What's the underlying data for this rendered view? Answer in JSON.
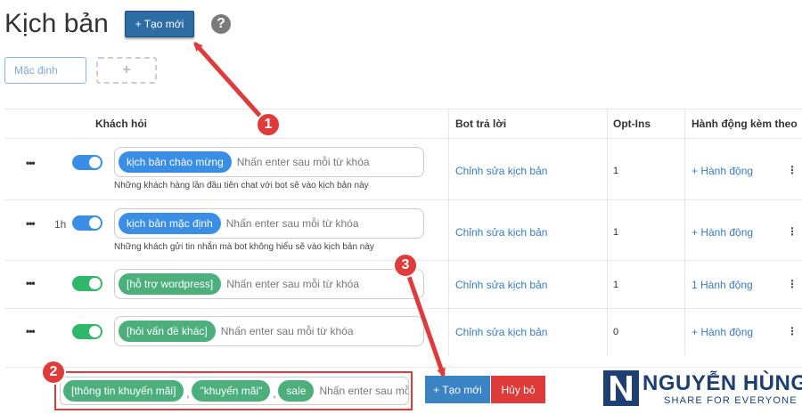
{
  "header": {
    "title": "Kịch bản",
    "new_button": "+ Tạo mới",
    "help_icon": "?"
  },
  "tabs": {
    "default_label": "Mặc định",
    "add_label": "+"
  },
  "table": {
    "columns": [
      "Khách hỏi",
      "Bot trả lời",
      "Opt-Ins",
      "Hành động kèm theo"
    ],
    "rows": [
      {
        "menu": "•••",
        "prefix": "",
        "toggle_color": "blue",
        "keyword": "kịch bản chào mừng",
        "placeholder": "Nhấn enter sau mỗi từ khóa",
        "description": "Những khách hàng lần đầu tiên chat với bot sẽ vào kịch bản này",
        "bot_link": "Chỉnh sửa kịch bản",
        "optins": "1",
        "action": "+ Hành động",
        "kebab": "⋮"
      },
      {
        "menu": "•••",
        "prefix": "1h",
        "toggle_color": "blue",
        "keyword": "kịch bản mặc định",
        "placeholder": "Nhấn enter sau mỗi từ khóa",
        "description": "Những khách gửi tin nhắn mà bot không hiểu sẽ vào kịch bản này",
        "bot_link": "Chỉnh sửa kịch bản",
        "optins": "1",
        "action": "+ Hành động",
        "kebab": "⋮"
      },
      {
        "menu": "•••",
        "prefix": "",
        "toggle_color": "green",
        "keyword": "[hỗ trợ wordpress]",
        "placeholder": "Nhấn enter sau mỗi từ khóa",
        "description": "",
        "bot_link": "Chỉnh sửa kịch bản",
        "optins": "1",
        "action": "1 Hành động",
        "kebab": "⋮"
      },
      {
        "menu": "•••",
        "prefix": "",
        "toggle_color": "green",
        "keyword": "[hỏi vấn đề khác]",
        "placeholder": "Nhấn enter sau mỗi từ khóa",
        "description": "",
        "bot_link": "Chỉnh sửa kịch bản",
        "optins": "0",
        "action": "+ Hành động",
        "kebab": "⋮"
      }
    ]
  },
  "new_row": {
    "keywords": [
      "[thông tin khuyến mãi]",
      "\"khuyến mãi\"",
      "sale"
    ],
    "separator": ",",
    "placeholder": "Nhấn enter sau mỗi từ khóa",
    "create_button": "+ Tạo mới",
    "cancel_button": "Hủy bỏ"
  },
  "annotations": {
    "badges": [
      "1",
      "2",
      "3"
    ],
    "color": "#e03b3b"
  },
  "logo": {
    "name": "NGUYỄN HÙNG",
    "tagline": "SHARE FOR EVERYONE",
    "color": "#1d3f72"
  },
  "colors": {
    "primary": "#2e6da4",
    "toggle_blue": "#3a8ee6",
    "toggle_green": "#2fb86a",
    "chip_green": "#4caf7c",
    "danger": "#e03b3b",
    "link": "#3a7bbf"
  }
}
